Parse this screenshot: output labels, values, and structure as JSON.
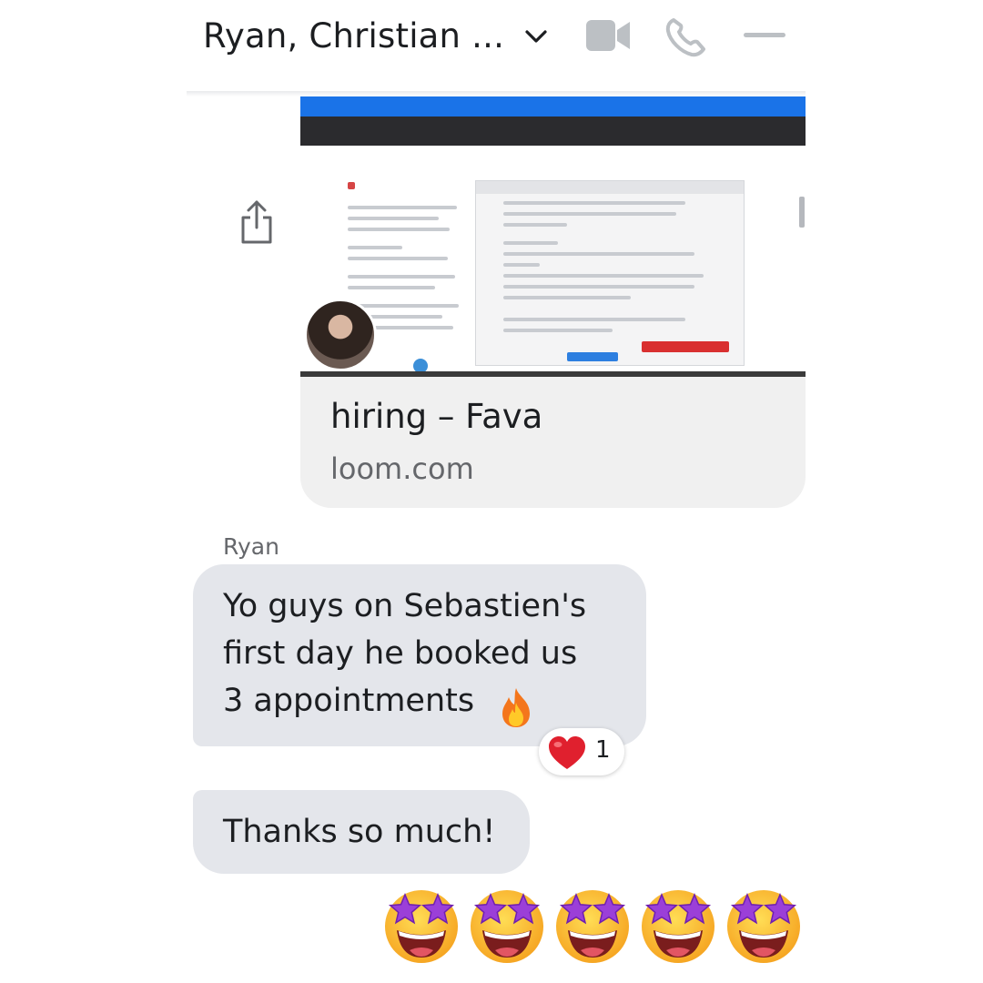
{
  "header": {
    "title": "Ryan, Christian ...",
    "icons": [
      "chevron-down-icon",
      "video-call-icon",
      "phone-icon",
      "minimize-icon"
    ]
  },
  "link_preview": {
    "title": "hiring – Fava",
    "domain": "loom.com",
    "share_icon": "share-icon"
  },
  "messages": [
    {
      "sender": "Ryan",
      "lines": [
        "Yo guys on Sebastien's",
        "first day he booked us",
        "3 appointments"
      ],
      "emoji": "fire-emoji",
      "reaction": {
        "icon": "heart-emoji",
        "count": "1"
      }
    },
    {
      "lines": [
        "Thanks so much!"
      ]
    }
  ],
  "emoji_reply": {
    "emoji": "star-struck-emoji",
    "count": 5
  },
  "colors": {
    "bubble": "#e4e6eb",
    "icon_gray": "#bcc0c4",
    "secondary_text": "#65676b",
    "loom_topbar": "#1a73e8"
  }
}
